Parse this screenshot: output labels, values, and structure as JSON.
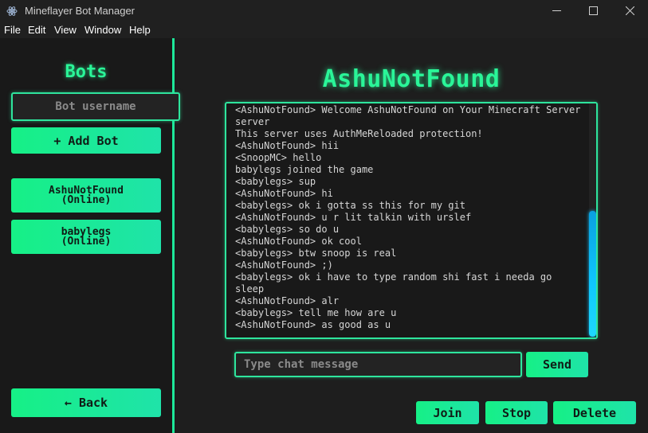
{
  "window": {
    "title": "Mineflayer Bot Manager",
    "minimize_icon": "minimize-icon",
    "maximize_icon": "maximize-icon",
    "close_icon": "close-icon"
  },
  "menu": [
    "File",
    "Edit",
    "View",
    "Window",
    "Help"
  ],
  "sidebar": {
    "heading": "Bots",
    "username_placeholder": "Bot username",
    "add_bot_label": "+ Add Bot",
    "bots": [
      {
        "name": "AshuNotFound",
        "status": "(Online)"
      },
      {
        "name": "babylegs",
        "status": "(Online)"
      }
    ],
    "back_label": "← Back"
  },
  "main": {
    "bot_title": "AshuNotFound",
    "chat_lines": [
      "<AshuNotFound> Welcome AshuNotFound on Your Minecraft Server server",
      "This server uses AuthMeReloaded protection!",
      "<AshuNotFound> hii",
      "<SnoopMC> hello",
      "babylegs joined the game",
      "<babylegs> sup",
      "<AshuNotFound> hi",
      "<babylegs> ok i gotta ss this for my git",
      "<AshuNotFound> u r lit talkin with urslef",
      "<babylegs> so do u",
      "<AshuNotFound> ok cool",
      "<babylegs> btw snoop is real",
      "<AshuNotFound> ;)",
      "<babylegs> ok i have to type random shi fast i needa go sleep",
      "<AshuNotFound> alr",
      "<babylegs> tell me how are u",
      "<AshuNotFound> as good as u"
    ],
    "chat_placeholder": "Type chat message",
    "send_label": "Send",
    "join_label": "Join",
    "stop_label": "Stop",
    "delete_label": "Delete"
  },
  "colors": {
    "accent_green": "#2af598",
    "button_gradient_start": "#16f086",
    "button_gradient_end": "#1fe3a9",
    "scrollbar_blue": "#10c8ff",
    "background": "#1e1e1e"
  }
}
